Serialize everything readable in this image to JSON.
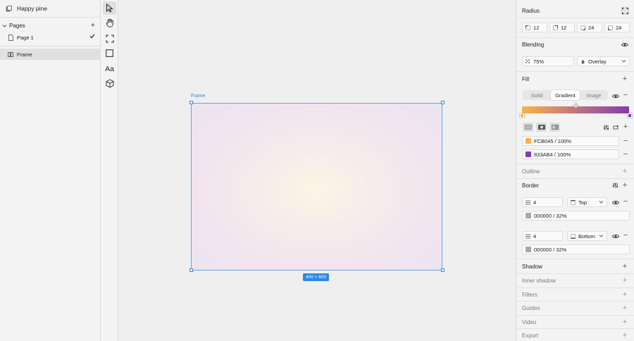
{
  "app": {
    "title": "Happy pine"
  },
  "pages": {
    "header": "Pages",
    "items": [
      {
        "label": "Page 1"
      }
    ]
  },
  "layers": [
    {
      "label": "Frame"
    }
  ],
  "toolbar": {
    "text_tool_label": "Aa"
  },
  "canvas": {
    "frame_label": "Frame",
    "dimensions_label": "400 × 600"
  },
  "inspector": {
    "radius": {
      "title": "Radius",
      "values": [
        "12",
        "12",
        "24",
        "24"
      ]
    },
    "blending": {
      "title": "Blending",
      "opacity": "75%",
      "mode": "Overlay"
    },
    "fill": {
      "title": "Fill",
      "tabs": [
        "Solid",
        "Gradient",
        "Image"
      ],
      "active_tab": "Gradient",
      "stops": [
        {
          "hex": "FCB045",
          "sep": "/",
          "opacity": "100%",
          "color": "#FCB045"
        },
        {
          "hex": "833AB4",
          "sep": "/",
          "opacity": "100%",
          "color": "#833AB4"
        }
      ]
    },
    "outline": {
      "title": "Outline"
    },
    "border": {
      "title": "Border",
      "items": [
        {
          "width": "4",
          "side": "Top",
          "hex": "000000",
          "sep": "/",
          "opacity": "32%"
        },
        {
          "width": "4",
          "side": "Bottom",
          "hex": "000000",
          "sep": "/",
          "opacity": "32%"
        }
      ]
    },
    "shadow": {
      "title": "Shadow"
    },
    "inner_shadow": {
      "title": "Inner shadow"
    },
    "filters": {
      "title": "Filters"
    },
    "guides": {
      "title": "Guides"
    },
    "video": {
      "title": "Video"
    },
    "export": {
      "title": "Export"
    }
  },
  "colors": {
    "accent": "#3b82d9",
    "selection": "#2f86e4"
  }
}
